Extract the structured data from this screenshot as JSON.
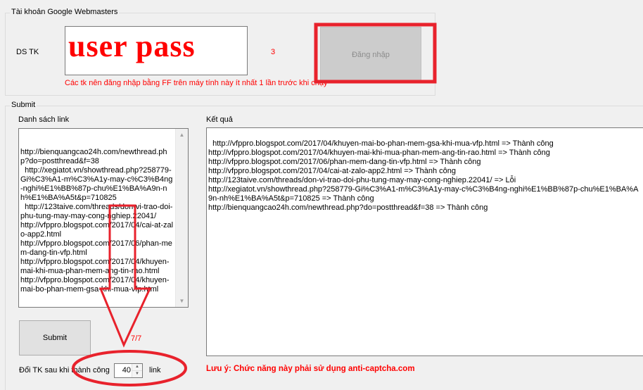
{
  "account_group": {
    "title": "Tài khoản Google Webmasters",
    "ds_tk_label": "DS TK",
    "account_text": "user pass",
    "count": "3",
    "login_button": "Đăng nhập",
    "note": "Các tk nên đăng nhập bằng FF trên máy tính này ít nhất 1 lần trước khi chạy"
  },
  "submit_group": {
    "title": "Submit",
    "link_list_label": "Danh sách link",
    "link_list_text": "\nhttp://bienquangcao24h.com/newthread.php?do=postthread&f=38\n  http://xegiatot.vn/showthread.php?258779-Gi%C3%A1-m%C3%A1y-may-c%C3%B4ng-nghi%E1%BB%87p-chu%E1%BA%A9n-nh%E1%BA%A5t&p=710825\n  http://123taive.com/threads/don-vi-trao-doi-phu-tung-may-may-cong-nghiep.22041/\nhttp://vfppro.blogspot.com/2017/04/cai-at-zalo-app2.html\nhttp://vfppro.blogspot.com/2017/06/phan-mem-dang-tin-vfp.html\nhttp://vfppro.blogspot.com/2017/04/khuyen-mai-khi-mua-phan-mem-ang-tin-rao.html\nhttp://vfppro.blogspot.com/2017/04/khuyen-mai-bo-phan-mem-gsa-khi-mua-vfp.html",
    "result_label": "Kết quả",
    "result_text": "http://vfppro.blogspot.com/2017/04/khuyen-mai-bo-phan-mem-gsa-khi-mua-vfp.html => Thành công\nhttp://vfppro.blogspot.com/2017/04/khuyen-mai-khi-mua-phan-mem-ang-tin-rao.html => Thành công\nhttp://vfppro.blogspot.com/2017/06/phan-mem-dang-tin-vfp.html => Thành công\nhttp://vfppro.blogspot.com/2017/04/cai-at-zalo-app2.html => Thành công\nhttp://123taive.com/threads/don-vi-trao-doi-phu-tung-may-may-cong-nghiep.22041/ => Lỗi\nhttp://xegiatot.vn/showthread.php?258779-Gi%C3%A1-m%C3%A1y-may-c%C3%B4ng-nghi%E1%BB%87p-chu%E1%BA%A9n-nh%E1%BA%A5t&p=710825 => Thành công\nhttp://bienquangcao24h.com/newthread.php?do=postthread&f=38 => Thành công",
    "submit_button": "Submit",
    "progress": "7/7",
    "switch_label": "Đổi TK sau khi thành công",
    "switch_value": "40",
    "switch_unit": "link",
    "warning": "Lưu ý: Chức năng này phải sử dụng anti-captcha.com"
  },
  "colors": {
    "annotation_red": "#e8222c",
    "text_red": "#ff0000",
    "window_bg": "#f0f0f0"
  }
}
